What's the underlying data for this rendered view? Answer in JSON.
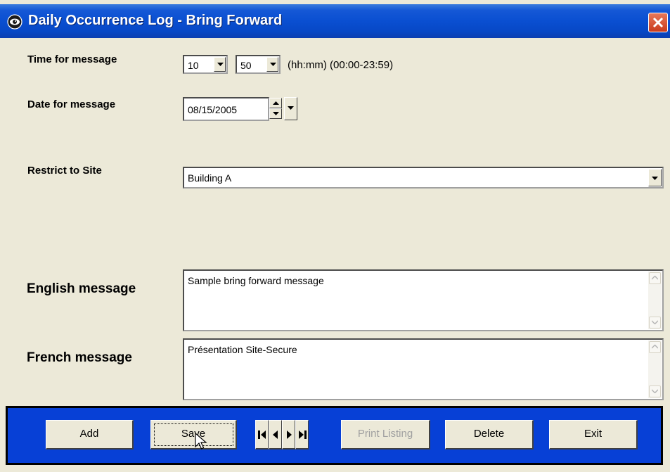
{
  "window": {
    "title": "Daily Occurrence Log - Bring Forward",
    "close_label": "X"
  },
  "time": {
    "label": "Time for message",
    "hour": "10",
    "minute": "50",
    "hint": "(hh:mm) (00:00-23:59)"
  },
  "date": {
    "label": "Date for message",
    "value": "08/15/2005"
  },
  "site": {
    "label": "Restrict to Site",
    "value": "Building A"
  },
  "english": {
    "label": "English message",
    "value": "Sample bring forward message"
  },
  "french": {
    "label": "French message",
    "value": "Présentation Site-Secure"
  },
  "toolbar": {
    "add_label": "Add",
    "save_label": "Save",
    "print_label": "Print Listing",
    "print_enabled": false,
    "delete_label": "Delete",
    "exit_label": "Exit"
  },
  "icons": {
    "app": "eye-icon",
    "close": "close-icon",
    "nav": [
      "first-record-icon",
      "prev-record-icon",
      "next-record-icon",
      "last-record-icon"
    ]
  },
  "colors": {
    "titlebar": "#0a4fd1",
    "toolbar": "#0740d6",
    "window_bg": "#ece9d8",
    "close_button": "#c93b1c"
  }
}
